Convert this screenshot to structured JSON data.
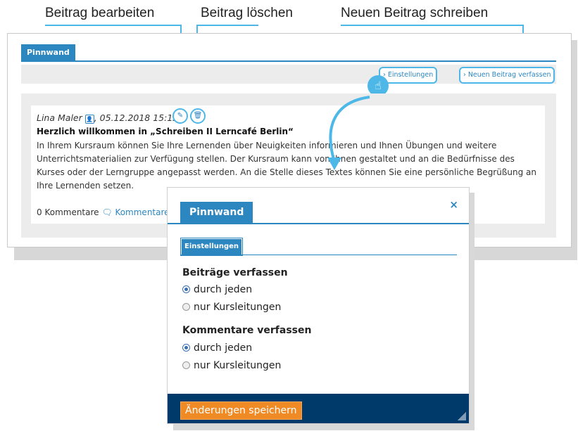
{
  "callouts": {
    "edit": "Beitrag bearbeiten",
    "delete": "Beitrag löschen",
    "new": "Neuen Beitrag schreiben"
  },
  "board": {
    "tab": "Pinnwand",
    "toolbar": {
      "settings": "› Einstellungen",
      "new_post": "› Neuen Beitrag verfassen"
    },
    "post": {
      "author": "Lina Maler",
      "datetime": ", 05.12.2018 15:13",
      "title": "Herzlich willkommen in „Schreiben II Lerncafé Berlin“",
      "body": "In Ihrem Kursraum können Sie Ihre Lernenden über Neuigkeiten informieren und Ihnen Übungen und weitere Unterrichtsmaterialien zur Verfügung stellen. Der Kursraum kann von Ihnen gestaltet und an die Bedürfnisse des Kurses oder der Lerngruppe angepasst werden. An die Stelle dieses Textes können Sie eine persönliche Begrüßung an Ihre Lernenden setzen.",
      "comments_count": "0 Kommentare",
      "comments_link": "Kommentare"
    }
  },
  "modal": {
    "tab": "Pinnwand",
    "close": "×",
    "subtab": "Einstellungen",
    "section1": {
      "title": "Beiträge verfassen",
      "options": [
        "durch jeden",
        "nur Kursleitungen"
      ],
      "selected": "durch jeden"
    },
    "section2": {
      "title": "Kommentare verfassen",
      "options": [
        "durch jeden",
        "nur Kursleitungen"
      ],
      "selected": "durch jeden"
    },
    "save": "Änderungen speichern"
  },
  "colors": {
    "accent": "#2c86c0",
    "callout": "#4db8e8",
    "footer": "#003a6b",
    "button": "#f08a24"
  }
}
